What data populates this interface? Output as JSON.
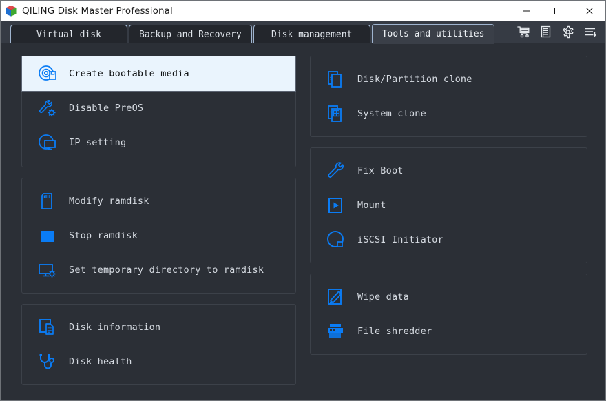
{
  "window": {
    "title": "QILING Disk Master Professional",
    "logo_icon": "cube-logo-icon",
    "controls": [
      {
        "name": "minimize",
        "icon": "minimize-icon"
      },
      {
        "name": "maximize",
        "icon": "maximize-icon"
      },
      {
        "name": "close",
        "icon": "close-icon"
      }
    ]
  },
  "tabs": [
    {
      "label": "Virtual disk",
      "active": false
    },
    {
      "label": "Backup and Recovery",
      "active": false
    },
    {
      "label": "Disk management",
      "active": false
    },
    {
      "label": "Tools and utilities",
      "active": true
    }
  ],
  "toolbar": [
    {
      "name": "cart-icon",
      "title": "cart"
    },
    {
      "name": "log-icon",
      "title": "log"
    },
    {
      "name": "gear-icon",
      "title": "settings"
    },
    {
      "name": "menu-icon",
      "title": "menu"
    }
  ],
  "colors": {
    "window_bg": "#2b2f36",
    "tabbar_bg": "#363b44",
    "panel_border": "#3c4149",
    "accent_blue": "#0a7cf5",
    "selected_bg": "#eaf4fd",
    "label_text": "#d5dae1",
    "titlebar_bg": "#ffffff"
  },
  "panels": {
    "left": [
      {
        "name": "boot-media-panel",
        "items": [
          {
            "label": "Create bootable media",
            "icon": "disc-media-icon",
            "selected": true
          },
          {
            "label": "Disable PreOS",
            "icon": "wrench-gear-icon",
            "selected": false
          },
          {
            "label": "IP setting",
            "icon": "network-monitor-icon",
            "selected": false
          }
        ]
      },
      {
        "name": "ramdisk-panel",
        "items": [
          {
            "label": "Modify ramdisk",
            "icon": "memory-card-icon",
            "selected": false
          },
          {
            "label": "Stop ramdisk",
            "icon": "stop-square-icon",
            "selected": false
          },
          {
            "label": "Set temporary directory to ramdisk",
            "icon": "monitor-gear-icon",
            "selected": false
          }
        ]
      },
      {
        "name": "disk-info-panel",
        "items": [
          {
            "label": "Disk information",
            "icon": "disk-document-icon",
            "selected": false
          },
          {
            "label": "Disk health",
            "icon": "stethoscope-icon",
            "selected": false
          }
        ]
      }
    ],
    "right": [
      {
        "name": "clone-panel",
        "items": [
          {
            "label": "Disk/Partition clone",
            "icon": "clone-pages-icon",
            "selected": false
          },
          {
            "label": "System clone",
            "icon": "system-clone-icon",
            "selected": false
          }
        ]
      },
      {
        "name": "boot-tools-panel",
        "items": [
          {
            "label": "Fix Boot",
            "icon": "wrench-icon",
            "selected": false
          },
          {
            "label": "Mount",
            "icon": "mount-play-icon",
            "selected": false
          },
          {
            "label": "iSCSI Initiator",
            "icon": "iscsi-circle-icon",
            "selected": false
          }
        ]
      },
      {
        "name": "wipe-panel",
        "items": [
          {
            "label": "Wipe data",
            "icon": "wipe-pencil-icon",
            "selected": false
          },
          {
            "label": "File shredder",
            "icon": "shredder-icon",
            "selected": false
          }
        ]
      }
    ]
  }
}
